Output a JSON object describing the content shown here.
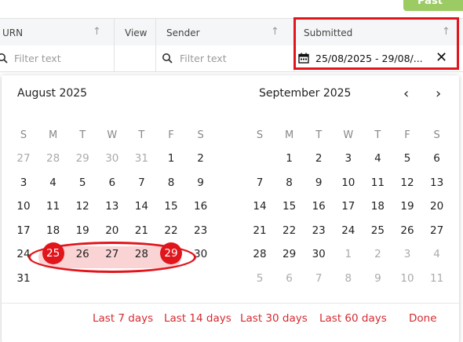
{
  "top_button": {
    "label": "Past"
  },
  "columns": [
    {
      "label": "URN",
      "filter_placeholder": "Filter text"
    },
    {
      "label": "View"
    },
    {
      "label": "Sender",
      "filter_placeholder": "Filter text"
    },
    {
      "label": "Submitted",
      "date_range_value": "25/08/2025 - 29/08/..."
    }
  ],
  "sort_arrow": "↑",
  "close_symbol": "✕",
  "nav": {
    "prev": "‹",
    "next": "›"
  },
  "left_month": {
    "title": "August 2025",
    "weekdays": [
      "S",
      "M",
      "T",
      "W",
      "T",
      "F",
      "S"
    ],
    "weeks": [
      [
        "27",
        "28",
        "29",
        "30",
        "31",
        "1",
        "2"
      ],
      [
        "3",
        "4",
        "5",
        "6",
        "7",
        "8",
        "9"
      ],
      [
        "10",
        "11",
        "12",
        "13",
        "14",
        "15",
        "16"
      ],
      [
        "17",
        "18",
        "19",
        "20",
        "21",
        "22",
        "23"
      ],
      [
        "24",
        "25",
        "26",
        "27",
        "28",
        "29",
        "30"
      ],
      [
        "31",
        "",
        "",
        "",
        "",
        "",
        ""
      ]
    ],
    "muted": [
      [
        0,
        0
      ],
      [
        0,
        1
      ],
      [
        0,
        2
      ],
      [
        0,
        3
      ],
      [
        0,
        4
      ]
    ]
  },
  "right_month": {
    "title": "September 2025",
    "weekdays": [
      "S",
      "M",
      "T",
      "W",
      "T",
      "F",
      "S"
    ],
    "weeks": [
      [
        "",
        "1",
        "2",
        "3",
        "4",
        "5",
        "6"
      ],
      [
        "7",
        "8",
        "9",
        "10",
        "11",
        "12",
        "13"
      ],
      [
        "14",
        "15",
        "16",
        "17",
        "18",
        "19",
        "20"
      ],
      [
        "21",
        "22",
        "23",
        "24",
        "25",
        "26",
        "27"
      ],
      [
        "28",
        "29",
        "30",
        "1",
        "2",
        "3",
        "4"
      ],
      [
        "5",
        "6",
        "7",
        "8",
        "9",
        "10",
        "11"
      ]
    ],
    "muted": [
      [
        4,
        3
      ],
      [
        4,
        4
      ],
      [
        4,
        5
      ],
      [
        4,
        6
      ],
      [
        5,
        0
      ],
      [
        5,
        1
      ],
      [
        5,
        2
      ],
      [
        5,
        3
      ],
      [
        5,
        4
      ],
      [
        5,
        5
      ],
      [
        5,
        6
      ]
    ]
  },
  "selection": {
    "start": "25",
    "end": "29",
    "in_range": [
      "26",
      "27",
      "28"
    ]
  },
  "presets": [
    "Last 7 days",
    "Last 14 days",
    "Last 30 days",
    "Last 60 days"
  ],
  "done_label": "Done",
  "colors": {
    "accent": "#e0161c",
    "range_fill": "#fad3d4",
    "preset_text": "#d42a2f"
  }
}
